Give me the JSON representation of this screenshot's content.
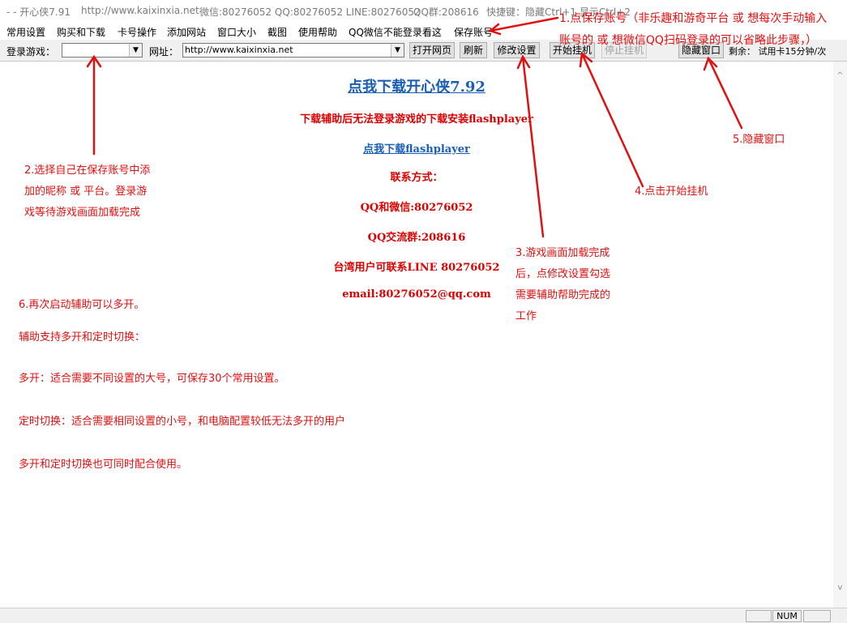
{
  "title_bar": {
    "app_title": "- - 开心侠7.91",
    "website": "http://www.kaixinxia.net",
    "contacts": "微信:80276052 QQ:80276052 LINE:80276052",
    "qq_group": "QQ群:208616",
    "shortcut": "快捷键：隐藏Ctrl+1 显示Ctrl+2"
  },
  "menu": {
    "items": [
      "常用设置",
      "购买和下载",
      "卡号操作",
      "添加网站",
      "窗口大小",
      "截图",
      "使用帮助",
      "QQ微信不能登录看这",
      "保存账号"
    ]
  },
  "toolbar": {
    "login_game_label": "登录游戏：",
    "login_game_value": "",
    "url_label": "网址：",
    "url_value": "http://www.kaixinxia.net",
    "open_page": "打开网页",
    "refresh": "刷新",
    "modify_settings": "修改设置",
    "start_hangup": "开始挂机",
    "stop_hangup": "停止挂机",
    "hide_window": "隐藏窗口",
    "remaining": "剩余：   试用卡15分钟/次"
  },
  "content": {
    "download_link": "点我下载开心侠7.92",
    "flash_notice": "下载辅助后无法登录游戏的下载安装flashplayer",
    "flash_link": "点我下载flashplayer",
    "contact_heading": "联系方式：",
    "qq_wechat": "QQ和微信:80276052",
    "qq_group": "QQ交流群:208616",
    "taiwan": "台湾用户可联系LINE 80276052",
    "email": "email:80276052@qq.com"
  },
  "annotations": {
    "step1_line1": "1.点保存账号（非乐趣和游奇平台 或 想每次手动输入",
    "step1_line2": "账号的 或 想微信QQ扫码登录的可以省略此步骤，）",
    "step2_lines": [
      "2.选择自己在保存账号中添",
      "加的昵称 或 平台。登录游",
      "戏等待游戏画面加载完成"
    ],
    "step3_lines": [
      "3.游戏画面加载完成",
      "后，点修改设置勾选",
      "需要辅助帮助完成的",
      "工作"
    ],
    "step4": "4.点击开始挂机",
    "step5": "5.隐藏窗口",
    "step6": "6.再次启动辅助可以多开。",
    "multi_support": "辅助支持多开和定时切换：",
    "multi_desc": "多开：适合需要不同设置的大号，可保存30个常用设置。",
    "timer_desc": "定时切换：适合需要相同设置的小号，和电脑配置较低无法多开的用户",
    "combined": "多开和定时切换也可同时配合使用。"
  },
  "status_bar": {
    "num": "NUM"
  },
  "colors": {
    "annotation": "#e01010",
    "link": "#1a5fb4",
    "content_red": "#dd0000"
  }
}
